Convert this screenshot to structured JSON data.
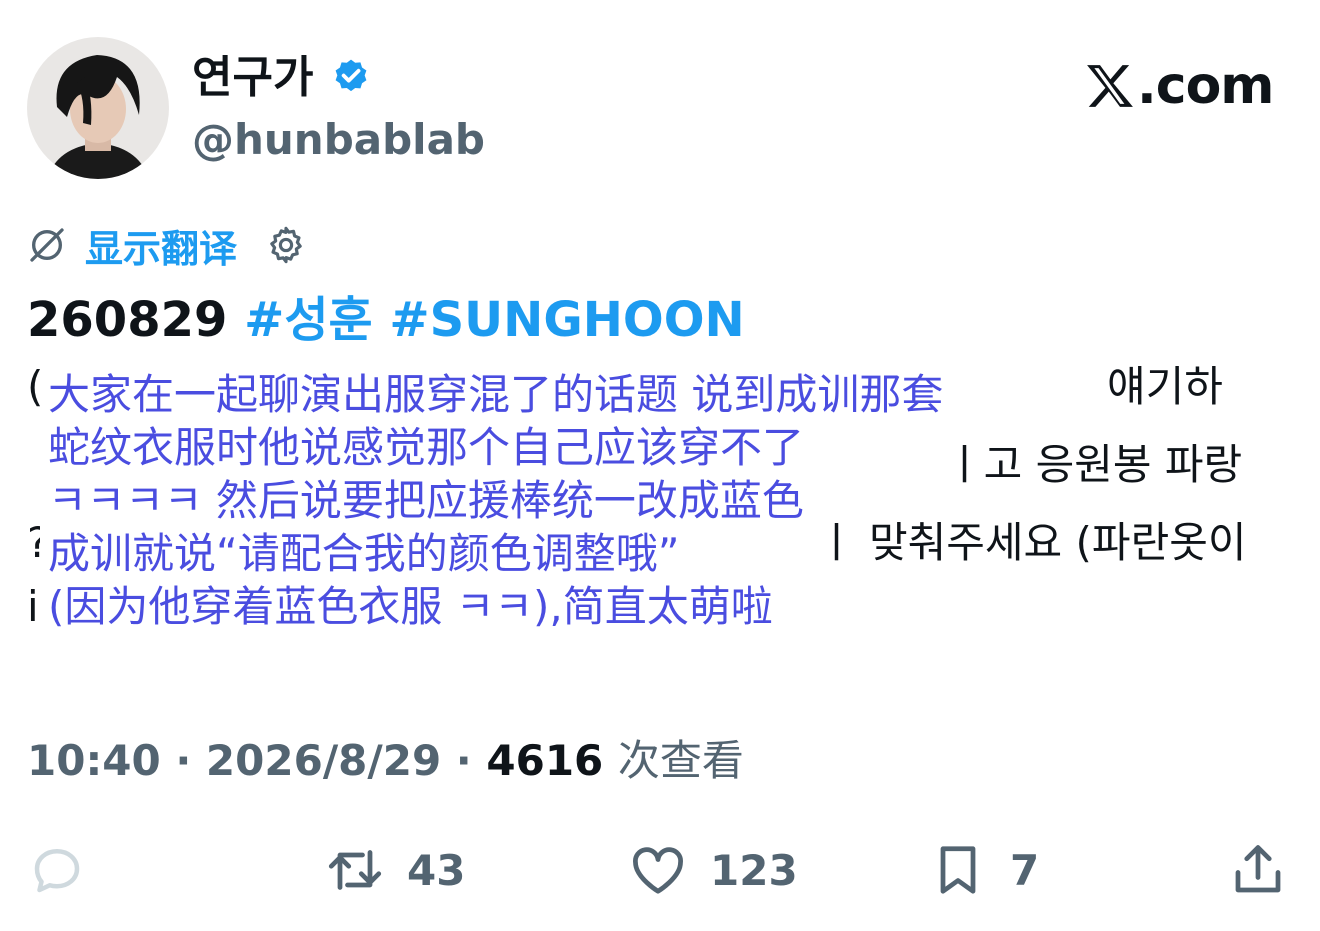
{
  "author": {
    "display_name": "연구가",
    "handle": "@hunbablab",
    "verified_icon": "verified-badge-icon"
  },
  "brand": {
    "logo_icon": "x-logo-icon",
    "text": ".com"
  },
  "translate": {
    "label": "显示翻译",
    "icon": "translate-off-icon",
    "settings_icon": "gear-icon"
  },
  "tweet": {
    "date": "260829",
    "hashtag1": "#성훈",
    "hashtag2": "#SUNGHOON",
    "orig_fragments": [
      "( ",
      "얘기하",
      "ㅣ",
      "ㅣ고 응원봉 파랑",
      "? ",
      "ㅣ 맞춰주세요 (파란옷이",
      "i "
    ],
    "translation_lines": [
      "大家在一起聊演出服穿混了的话题 说到成训那套",
      "蛇纹衣服时他说感觉那个自己应该穿不了",
      " ㅋㅋㅋㅋ 然后说要把应援棒统一改成蓝色",
      "成训就说“请配合我的颜色调整哦”",
      "(因为他穿着蓝色衣服 ㅋㅋ),简直太萌啦"
    ]
  },
  "meta": {
    "time": "10:40",
    "sep": "·",
    "date": "2026/8/29",
    "views": "4616",
    "views_label": "次查看"
  },
  "actions": {
    "reply_icon": "reply-icon",
    "retweet_icon": "retweet-icon",
    "retweet_count": "43",
    "like_icon": "heart-icon",
    "like_count": "123",
    "bookmark_icon": "bookmark-icon",
    "bookmark_count": "7",
    "share_icon": "share-icon"
  },
  "colors": {
    "link": "#1d9bf0",
    "text": "#0f1419",
    "muted": "#536471",
    "translation": "#4a4de0"
  }
}
